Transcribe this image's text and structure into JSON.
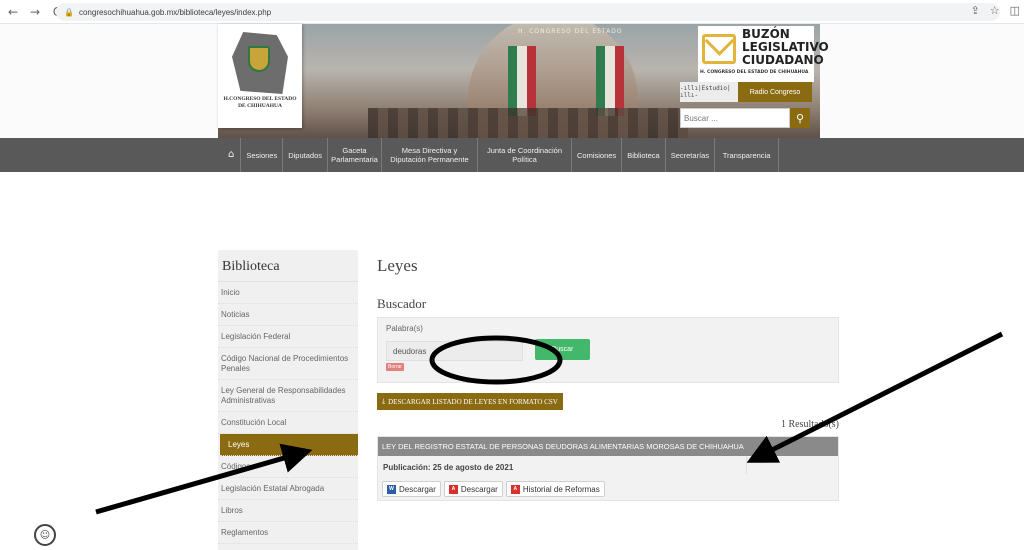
{
  "browser": {
    "back_icon": "arrow-left-icon",
    "back": "←",
    "forward": "→",
    "reload": "C",
    "lock": "🔒",
    "url": "congresochihuahua.gob.mx/biblioteca/leyes/index.php",
    "share": "⇪",
    "star": "☆",
    "panel": "◫"
  },
  "header": {
    "logo_text": "H.CONGRESO DEL ESTADO DE CHIHUAHUA",
    "banner_text": "H. CONGRESO DEL ESTADO",
    "buzon_line1": "BUZÓN",
    "buzon_line2": "LEGISLATIVO",
    "buzon_line3": "CIUDADANO",
    "buzon_sub": "H. CONGRESO DEL ESTADO DE CHIHUAHUA",
    "radio_wave": "-ıllı|Estudio|ıllı-",
    "radio_label": "Radio Congreso",
    "search_placeholder": "Buscar ...",
    "search_icon": "magnifier-icon",
    "search_glyph": "⚲"
  },
  "nav": {
    "home_glyph": "⌂",
    "items": [
      "Sesiones",
      "Diputados",
      "Gaceta Parlamentaria",
      "Mesa Directiva y Diputación Permanente",
      "Junta de Coordinación Política",
      "Comisiones",
      "Biblioteca",
      "Secretarías",
      "Transparencia"
    ]
  },
  "sidebar": {
    "title": "Biblioteca",
    "items": [
      "Inicio",
      "Noticias",
      "Legislación Federal",
      "Código Nacional de Procedimientos Penales",
      "Ley General de Responsabilidades Administrativas",
      "Constitución Local",
      "Leyes",
      "Códigos",
      "Legislación Estatal Abrogada",
      "Libros",
      "Reglamentos"
    ],
    "active_index": 6
  },
  "main": {
    "title": "Leyes",
    "section": "Buscador",
    "keyword_label": "Palabra(s)",
    "keyword_value": "deudoras",
    "search_button": "Buscar",
    "clear_button": "Borrar",
    "download_icon": "download-icon",
    "download_glyph": "⤓",
    "csv_button": "DESCARGAR LISTADO DE LEYES EN FORMATO CSV",
    "result_count": "1 Resultado(s)",
    "result": {
      "title": "LEY DEL REGISTRO ESTATAL DE PERSONAS DEUDORAS ALIMENTARIAS MOROSAS DE CHIHUAHUA",
      "pub_label": "Publicación: 25 de agosto de 2021",
      "word_glyph": "W",
      "pdf_glyph": "A",
      "download_word": "Descargar",
      "download_pdf": "Descargar",
      "history": "Historial de Reformas"
    }
  },
  "accessibility_glyph": "☺",
  "colors": {
    "accent": "#8a6b12",
    "nav_bg": "#595959",
    "search_green": "#44b86a",
    "annotation": "#000000"
  }
}
